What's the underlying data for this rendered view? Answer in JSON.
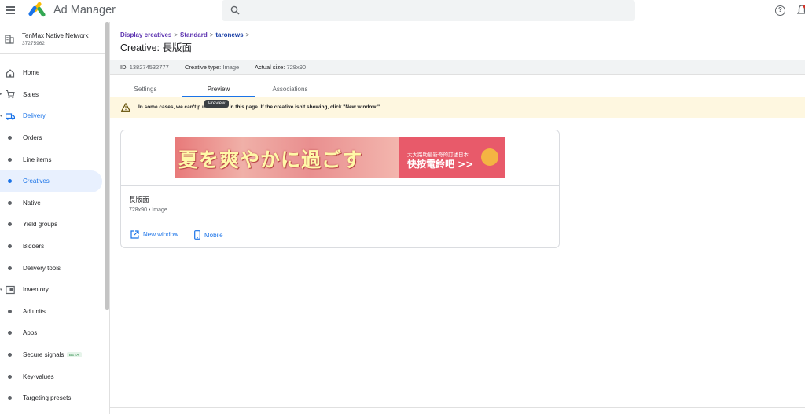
{
  "app": {
    "name": "Ad Manager"
  },
  "network": {
    "name": "TenMax Native Network",
    "id": "37275962"
  },
  "sidebar": {
    "items": [
      {
        "label": "Home",
        "icon": "home-icon"
      },
      {
        "label": "Sales",
        "icon": "cart-icon"
      },
      {
        "label": "Delivery",
        "icon": "truck-icon"
      },
      {
        "label": "Orders"
      },
      {
        "label": "Line items"
      },
      {
        "label": "Creatives"
      },
      {
        "label": "Native"
      },
      {
        "label": "Yield groups"
      },
      {
        "label": "Bidders"
      },
      {
        "label": "Delivery tools"
      },
      {
        "label": "Inventory",
        "icon": "inventory-icon"
      },
      {
        "label": "Ad units"
      },
      {
        "label": "Apps"
      },
      {
        "label": "Secure signals",
        "badge": "BETA"
      },
      {
        "label": "Key-values"
      },
      {
        "label": "Targeting presets"
      }
    ]
  },
  "breadcrumb": {
    "items": [
      "Display creatives",
      "Standard",
      "taronews"
    ]
  },
  "page": {
    "title": "Creative: 長版面"
  },
  "meta": {
    "id_label": "ID:",
    "id_value": "138274532777",
    "type_label": "Creative type:",
    "type_value": "Image",
    "size_label": "Actual size:",
    "size_value": "728x90"
  },
  "tabs": [
    {
      "label": "Settings"
    },
    {
      "label": "Preview"
    },
    {
      "label": "Associations"
    }
  ],
  "tooltip": "Preview",
  "warning": "In some cases, we can't p        ur creative in this page. If the creative isn't showing, click \"New window.\"",
  "banner": {
    "headline": "夏を爽やかに過ごす",
    "subtext": "大大路助最新奇的訂述日本",
    "cta": "快按電鈴吧 >>"
  },
  "creative": {
    "name": "長版面",
    "details": "728x90 • Image"
  },
  "actions": {
    "new_window": "New window",
    "mobile": "Mobile"
  },
  "colors": {
    "accent": "#1a73e8",
    "selected_bg": "#e8f0fe",
    "warning_bg": "#fef7e0"
  }
}
